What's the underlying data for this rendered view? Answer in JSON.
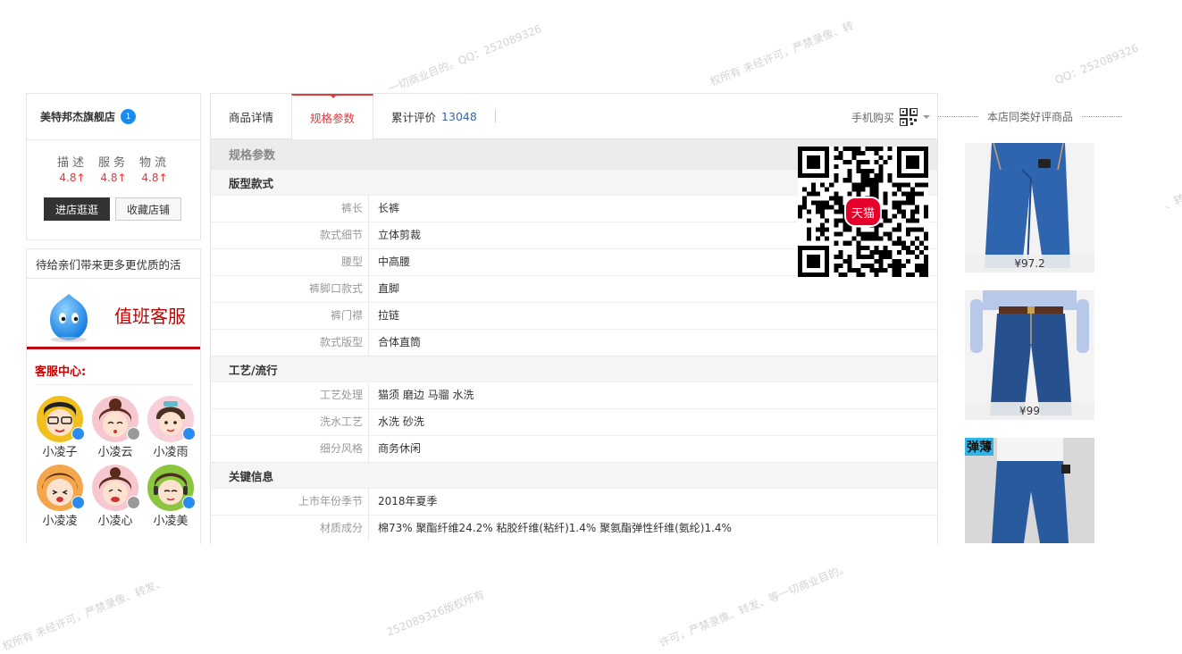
{
  "watermarks": [
    "一切商业目的。QQ：252089326",
    "权所有 未经许可，严禁录像、转",
    "QQ：252089326",
    "、转发、",
    "权所有 未经许可，严禁录像、转发、",
    "252089326版权所有",
    "许可，严禁录像、转发、等一切商业目的。"
  ],
  "shop": {
    "name": "美特邦杰旗舰店",
    "badge": "1",
    "ratings": [
      {
        "label": "描述",
        "value": "4.8"
      },
      {
        "label": "服务",
        "value": "4.8"
      },
      {
        "label": "物流",
        "value": "4.8"
      }
    ],
    "arrow": "↑",
    "enter_label": "进店逛逛",
    "favorite_label": "收藏店铺"
  },
  "service": {
    "notice": "待给亲们带来更多更优质的活",
    "title": "值班客服",
    "center_label": "客服中心:",
    "agents": [
      "小凌子",
      "小凌云",
      "小凌雨",
      "小凌凌",
      "小凌心",
      "小凌美"
    ]
  },
  "tabs": {
    "detail": "商品详情",
    "specs": "规格参数",
    "reviews": "累计评价",
    "review_count": "13048",
    "mobile_buy": "手机购买"
  },
  "specs": {
    "header": "规格参数",
    "groups": [
      {
        "name": "版型款式",
        "rows": [
          {
            "k": "裤长",
            "v": "长裤"
          },
          {
            "k": "款式细节",
            "v": "立体剪裁"
          },
          {
            "k": "腰型",
            "v": "中高腰"
          },
          {
            "k": "裤脚口款式",
            "v": "直脚"
          },
          {
            "k": "裤门襟",
            "v": "拉链"
          },
          {
            "k": "款式版型",
            "v": "合体直筒"
          }
        ]
      },
      {
        "name": "工艺/流行",
        "rows": [
          {
            "k": "工艺处理",
            "v": "猫须 磨边 马骝 水洗"
          },
          {
            "k": "洗水工艺",
            "v": "水洗 砂洗"
          },
          {
            "k": "细分风格",
            "v": "商务休闲"
          }
        ]
      },
      {
        "name": "关键信息",
        "rows": [
          {
            "k": "上市年份季节",
            "v": "2018年夏季"
          },
          {
            "k": "材质成分",
            "v": "棉73% 聚酯纤维24.2% 粘胶纤维(粘纤)1.4% 聚氨酯弹性纤维(氨纶)1.4%"
          }
        ]
      }
    ]
  },
  "qr": {
    "brand": "天猫"
  },
  "recommend": {
    "title": "本店同类好评商品",
    "items": [
      {
        "price": "¥97.2"
      },
      {
        "price": "¥99"
      },
      {
        "tag": "弹薄"
      }
    ]
  },
  "colors": {
    "accent": "#e4393c",
    "service_red": "#c40000",
    "link_blue": "#3a64a6",
    "denim": "#2a5a9e"
  }
}
